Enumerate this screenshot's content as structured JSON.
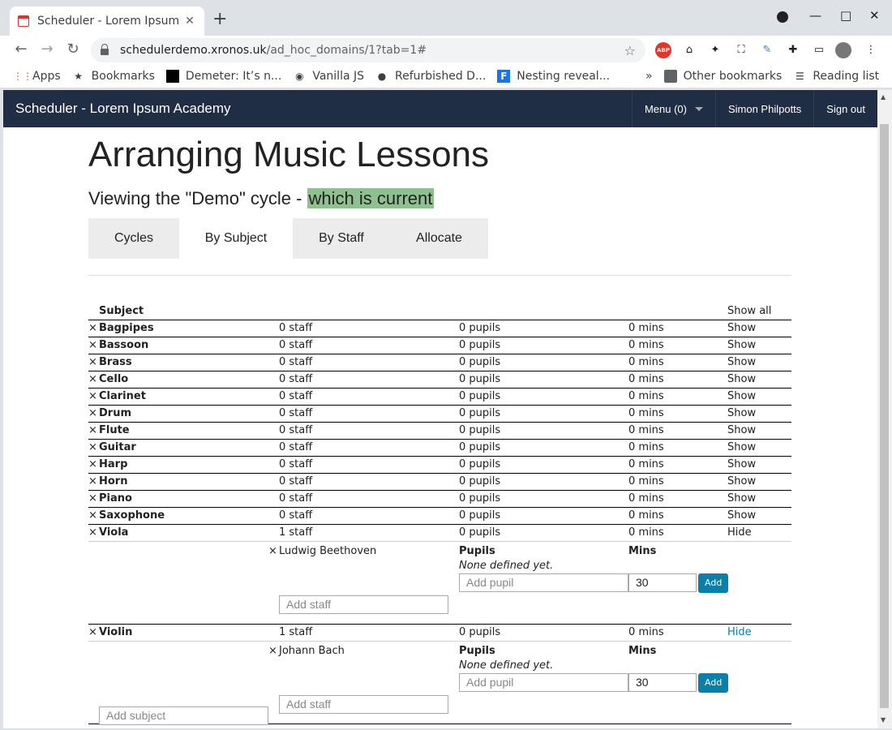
{
  "browser": {
    "tab_title": "Scheduler - Lorem Ipsum Academy",
    "url_host": "schedulerdemo.xronos.uk",
    "url_path": "/ad_hoc_domains/1?tab=1#",
    "bookmarks": [
      {
        "label": "Apps",
        "icon": "apps-grid-icon"
      },
      {
        "label": "Bookmarks",
        "icon": "star-icon"
      },
      {
        "label": "Demeter: It’s n...",
        "icon": "black-square-icon"
      },
      {
        "label": "Vanilla JS",
        "icon": "globe-icon"
      },
      {
        "label": "Refurbished D...",
        "icon": "circle-icon"
      },
      {
        "label": "Nesting reveal...",
        "icon": "f-icon"
      }
    ],
    "other_bookmarks": "Other bookmarks",
    "reading_list": "Reading list"
  },
  "app": {
    "brand": "Scheduler - Lorem Ipsum Academy",
    "menu": "Menu (0)",
    "user": "Simon Philpotts",
    "signout": "Sign out"
  },
  "page": {
    "title": "Arranging Music Lessons",
    "subtitle_prefix": "Viewing the \"Demo\" cycle - ",
    "subtitle_highlight": "which is current",
    "tabs": [
      "Cycles",
      "By Subject",
      "By Staff",
      "Allocate"
    ],
    "active_tab": "By Subject"
  },
  "table": {
    "header_subject": "Subject",
    "show_all": "Show all",
    "subjects": [
      {
        "name": "Bagpipes",
        "staff": "0 staff",
        "pupils": "0 pupils",
        "mins": "0 mins",
        "action": "Show"
      },
      {
        "name": "Bassoon",
        "staff": "0 staff",
        "pupils": "0 pupils",
        "mins": "0 mins",
        "action": "Show"
      },
      {
        "name": "Brass",
        "staff": "0 staff",
        "pupils": "0 pupils",
        "mins": "0 mins",
        "action": "Show"
      },
      {
        "name": "Cello",
        "staff": "0 staff",
        "pupils": "0 pupils",
        "mins": "0 mins",
        "action": "Show"
      },
      {
        "name": "Clarinet",
        "staff": "0 staff",
        "pupils": "0 pupils",
        "mins": "0 mins",
        "action": "Show"
      },
      {
        "name": "Drum",
        "staff": "0 staff",
        "pupils": "0 pupils",
        "mins": "0 mins",
        "action": "Show"
      },
      {
        "name": "Flute",
        "staff": "0 staff",
        "pupils": "0 pupils",
        "mins": "0 mins",
        "action": "Show"
      },
      {
        "name": "Guitar",
        "staff": "0 staff",
        "pupils": "0 pupils",
        "mins": "0 mins",
        "action": "Show"
      },
      {
        "name": "Harp",
        "staff": "0 staff",
        "pupils": "0 pupils",
        "mins": "0 mins",
        "action": "Show"
      },
      {
        "name": "Horn",
        "staff": "0 staff",
        "pupils": "0 pupils",
        "mins": "0 mins",
        "action": "Show"
      },
      {
        "name": "Piano",
        "staff": "0 staff",
        "pupils": "0 pupils",
        "mins": "0 mins",
        "action": "Show"
      },
      {
        "name": "Saxophone",
        "staff": "0 staff",
        "pupils": "0 pupils",
        "mins": "0 mins",
        "action": "Show"
      },
      {
        "name": "Viola",
        "staff": "1 staff",
        "pupils": "0 pupils",
        "mins": "0 mins",
        "action": "Hide",
        "expanded": true,
        "teacher": "Ludwig Beethoven"
      },
      {
        "name": "Violin",
        "staff": "1 staff",
        "pupils": "0 pupils",
        "mins": "0 mins",
        "action": "Hide",
        "expanded": true,
        "teacher": "Johann Bach"
      }
    ],
    "pupils_header": "Pupils",
    "mins_header": "Mins",
    "none_defined": "None defined yet.",
    "add_pupil_placeholder": "Add pupil",
    "mins_default": "30",
    "add_button": "Add",
    "add_staff_placeholder": "Add staff",
    "add_subject_placeholder": "Add subject",
    "delete_glyph": "×"
  }
}
